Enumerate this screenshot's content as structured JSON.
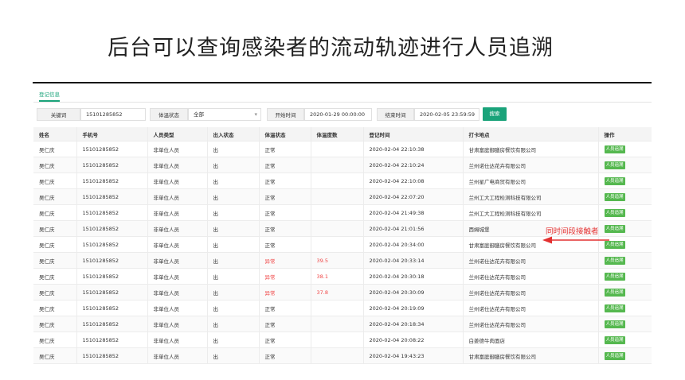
{
  "slide": {
    "title": "后台可以查询感染者的流动轨迹进行人员追溯"
  },
  "tabs": [
    {
      "label": "登记信息"
    }
  ],
  "filters": {
    "keyword_label": "关键词",
    "keyword_value": "15101285852",
    "temp_status_label": "体温状态",
    "temp_status_value": "全部",
    "start_label": "开始时间",
    "start_value": "2020-01-29 00:00:00",
    "end_label": "结束时间",
    "end_value": "2020-02-05 23:59:59",
    "search_label": "搜索"
  },
  "table": {
    "headers": [
      "姓名",
      "手机号",
      "人员类型",
      "出入状态",
      "体温状态",
      "体温度数",
      "登记时间",
      "打卡地点",
      "操作"
    ],
    "rows": [
      [
        "吴仁庆",
        "15101285852",
        "非单位人员",
        "出",
        "正常",
        "",
        "2020-02-04 22:10:38",
        "甘肃富庭御膳房餐饮有限公司",
        "人员追溯"
      ],
      [
        "吴仁庆",
        "15101285852",
        "非单位人员",
        "出",
        "正常",
        "",
        "2020-02-04 22:10:24",
        "兰州诺仕达花卉有限公司",
        "人员追溯"
      ],
      [
        "吴仁庆",
        "15101285852",
        "非单位人员",
        "出",
        "正常",
        "",
        "2020-02-04 22:10:08",
        "兰州星广电商贸有限公司",
        "人员追溯"
      ],
      [
        "吴仁庆",
        "15101285852",
        "非单位人员",
        "出",
        "正常",
        "",
        "2020-02-04 22:07:20",
        "兰州工大工程检测科技有限公司",
        "人员追溯"
      ],
      [
        "吴仁庆",
        "15101285852",
        "非单位人员",
        "出",
        "正常",
        "",
        "2020-02-04 21:49:38",
        "兰州工大工程检测科技有限公司",
        "人员追溯"
      ],
      [
        "吴仁庆",
        "15101285852",
        "非单位人员",
        "出",
        "正常",
        "",
        "2020-02-04 21:01:56",
        "西姆城堡",
        "人员追溯"
      ],
      [
        "吴仁庆",
        "15101285852",
        "非单位人员",
        "出",
        "正常",
        "",
        "2020-02-04 20:34:00",
        "甘肃富庭御膳房餐饮有限公司",
        "人员追溯"
      ],
      [
        "吴仁庆",
        "15101285852",
        "非单位人员",
        "出",
        "异常",
        "39.5",
        "2020-02-04 20:33:14",
        "兰州诺仕达花卉有限公司",
        "人员追溯"
      ],
      [
        "吴仁庆",
        "15101285852",
        "非单位人员",
        "出",
        "异常",
        "38.1",
        "2020-02-04 20:30:18",
        "兰州诺仕达花卉有限公司",
        "人员追溯"
      ],
      [
        "吴仁庆",
        "15101285852",
        "非单位人员",
        "出",
        "异常",
        "37.8",
        "2020-02-04 20:30:09",
        "兰州诺仕达花卉有限公司",
        "人员追溯"
      ],
      [
        "吴仁庆",
        "15101285852",
        "非单位人员",
        "出",
        "正常",
        "",
        "2020-02-04 20:19:09",
        "兰州诺仕达花卉有限公司",
        "人员追溯"
      ],
      [
        "吴仁庆",
        "15101285852",
        "非单位人员",
        "出",
        "正常",
        "",
        "2020-02-04 20:18:34",
        "兰州诺仕达花卉有限公司",
        "人员追溯"
      ],
      [
        "吴仁庆",
        "15101285852",
        "非单位人员",
        "出",
        "正常",
        "",
        "2020-02-04 20:08:22",
        "白姜德牛肉面店",
        "人员追溯"
      ],
      [
        "吴仁庆",
        "15101285852",
        "非单位人员",
        "出",
        "正常",
        "",
        "2020-02-04 19:43:23",
        "甘肃富庭御膳房餐饮有限公司",
        "人员追溯"
      ]
    ],
    "abnormal_color": "#f04848",
    "button_color": "#55b84f"
  },
  "annotation": {
    "text": "同时间段接触者",
    "color": "#e43030",
    "points_to_row": 7
  },
  "colors": {
    "accent": "#1aa37a"
  }
}
